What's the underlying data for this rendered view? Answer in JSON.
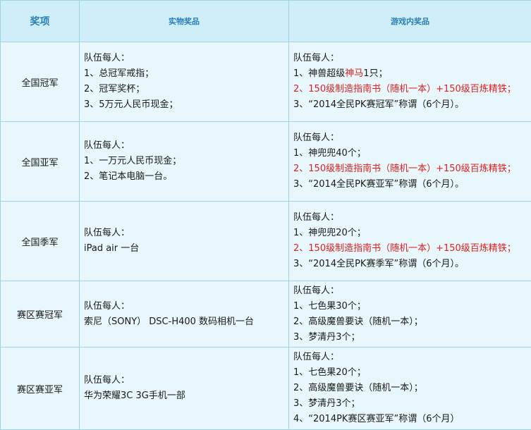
{
  "header": {
    "col_award": "奖项",
    "col_physical": "实物奖品",
    "col_ingame": "游戏内奖品"
  },
  "rows": [
    {
      "award": "全国冠军",
      "physical": [
        "队伍每人：",
        "1、总冠军戒指；",
        "2、冠军奖杯；",
        "3、5万元人民币现金；"
      ],
      "ingame": {
        "l0": "队伍每人：",
        "l1a": "1、神兽超级",
        "l1b": "神马",
        "l1c": "1只；",
        "l2": "2、150级制造指南书（随机一本）+150级百炼精铁；",
        "l3": "3、“2014全民PK赛冠军”称谓（6个月）。"
      }
    },
    {
      "award": "全国亚军",
      "physical": [
        "队伍每人：",
        "1、一万元人民币现金；",
        "2、笔记本电脑一台。"
      ],
      "ingame": {
        "l0": "队伍每人：",
        "l1": "1、神兜兜40个；",
        "l2": "2、150级制造指南书（随机一本）+150级百炼精铁；",
        "l3": "3、“2014全民PK赛亚军”称谓（6个月）。"
      }
    },
    {
      "award": "全国季军",
      "physical": [
        "队伍每人：",
        "iPad air 一台"
      ],
      "ingame": {
        "l0": "队伍每人：",
        "l1": "1、神兜兜20个；",
        "l2": "2、150级制造指南书（随机一本）+150级百炼精铁；",
        "l3": "3、“2014全民PK赛季军”称谓（6个月）。"
      }
    },
    {
      "award": "赛区赛冠军",
      "physical": [
        "队伍每人：",
        "索尼（SONY） DSC-H400 数码相机一台"
      ],
      "ingame": {
        "l0": "队伍每人：",
        "l1": "1、七色果30个；",
        "l2": "2、高级魔兽要诀（随机一本）；",
        "l3": "3、梦清丹3个；"
      }
    },
    {
      "award": "赛区赛亚军",
      "physical": [
        "队伍每人：",
        "华为荣耀3C 3G手机一部"
      ],
      "ingame": {
        "l0": "队伍每人：",
        "l1": "1、七色果20个；",
        "l2": "2、高级魔兽要诀（随机一本）；",
        "l3": "3、梦清丹3个；",
        "l4": "4、“2014PK赛区赛亚军”称谓（6个月）"
      }
    }
  ],
  "colors": {
    "header_bg": "#cfeef8",
    "header_text": "#2a7fb8",
    "cell_bg": "#e8f7fb",
    "border": "#9ed3e5",
    "highlight_red": "#e02020"
  }
}
